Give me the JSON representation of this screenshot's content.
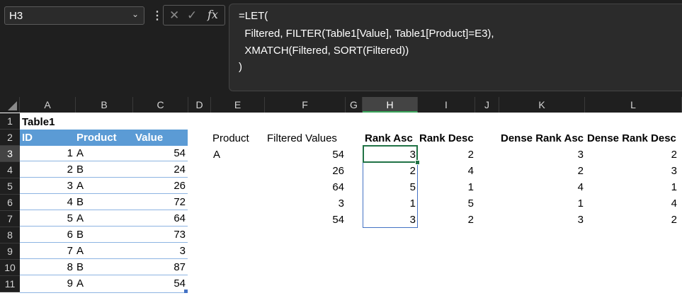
{
  "name_box": {
    "value": "H3"
  },
  "formula_bar": {
    "cancel_glyph": "✕",
    "enter_glyph": "✓",
    "fx_glyph": "fx",
    "lines": [
      "=LET(",
      "  Filtered, FILTER(Table1[Value], Table1[Product]=E3),",
      "  XMATCH(Filtered, SORT(Filtered))",
      ")"
    ]
  },
  "column_headers": [
    "A",
    "B",
    "C",
    "D",
    "E",
    "F",
    "G",
    "H",
    "I",
    "J",
    "K",
    "L"
  ],
  "row_headers": [
    "1",
    "2",
    "3",
    "4",
    "5",
    "6",
    "7",
    "8",
    "9",
    "10",
    "11"
  ],
  "selected": {
    "column": "H",
    "row": "3"
  },
  "table": {
    "title": "Table1",
    "headers": [
      "ID",
      "Product",
      "Value"
    ],
    "rows": [
      [
        "1",
        "A",
        "54"
      ],
      [
        "2",
        "B",
        "24"
      ],
      [
        "3",
        "A",
        "26"
      ],
      [
        "4",
        "B",
        "72"
      ],
      [
        "5",
        "A",
        "64"
      ],
      [
        "6",
        "B",
        "73"
      ],
      [
        "7",
        "A",
        "3"
      ],
      [
        "8",
        "B",
        "87"
      ],
      [
        "9",
        "A",
        "54"
      ]
    ]
  },
  "calc": {
    "labels": {
      "product": "Product",
      "filtered": "Filtered Values",
      "rank_asc": "Rank Asc",
      "rank_desc": "Rank Desc",
      "dense_asc": "Dense Rank Asc",
      "dense_desc": "Dense Rank Desc"
    },
    "product_value": "A",
    "rows": [
      {
        "filtered": "54",
        "rank_asc": "3",
        "rank_desc": "2",
        "dense_asc": "3",
        "dense_desc": "2"
      },
      {
        "filtered": "26",
        "rank_asc": "2",
        "rank_desc": "4",
        "dense_asc": "2",
        "dense_desc": "3"
      },
      {
        "filtered": "64",
        "rank_asc": "5",
        "rank_desc": "1",
        "dense_asc": "4",
        "dense_desc": "1"
      },
      {
        "filtered": "3",
        "rank_asc": "1",
        "rank_desc": "5",
        "dense_asc": "1",
        "dense_desc": "4"
      },
      {
        "filtered": "54",
        "rank_asc": "3",
        "rank_desc": "2",
        "dense_asc": "3",
        "dense_desc": "2"
      }
    ]
  },
  "colors": {
    "table_header": "#5b9bd5",
    "table_band": "#8db4e2",
    "selection": "#217346",
    "spill_border": "#4472c4"
  }
}
